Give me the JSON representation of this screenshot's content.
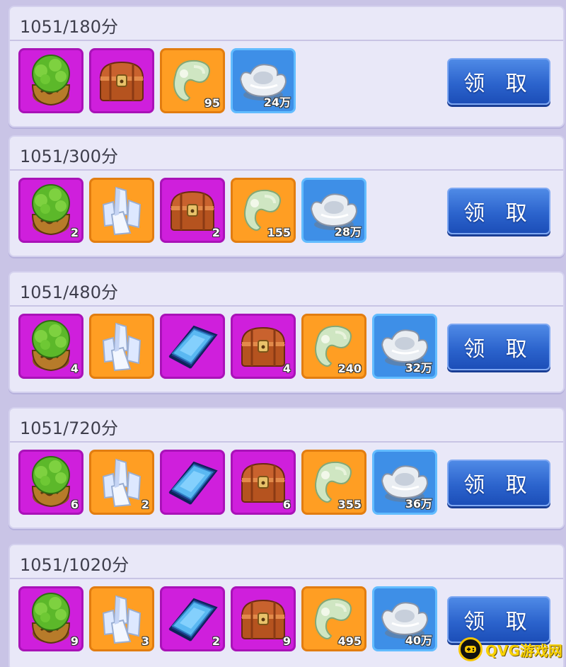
{
  "button_label": "领 取",
  "item_icons": {
    "bush": "bush-pot-icon",
    "crystal": "crystal-cluster-icon",
    "book": "skill-book-icon",
    "chest": "treasure-chest-icon",
    "jade": "jade-pendant-icon",
    "silver": "silver-ingot-icon"
  },
  "colors": {
    "purple": "#cf1fdc",
    "orange": "#ff9e23",
    "blue": "#3e8fe7",
    "button": "#2c64cd"
  },
  "tiers": [
    {
      "title": "1051/180分",
      "items": [
        {
          "icon": "bush",
          "bg": "purple",
          "qty": ""
        },
        {
          "icon": "chest",
          "bg": "purple",
          "qty": ""
        },
        {
          "icon": "jade",
          "bg": "orange",
          "qty": "95"
        },
        {
          "icon": "silver",
          "bg": "blue",
          "qty": "24万"
        }
      ]
    },
    {
      "title": "1051/300分",
      "items": [
        {
          "icon": "bush",
          "bg": "purple",
          "qty": "2"
        },
        {
          "icon": "crystal",
          "bg": "orange",
          "qty": ""
        },
        {
          "icon": "chest",
          "bg": "purple",
          "qty": "2"
        },
        {
          "icon": "jade",
          "bg": "orange",
          "qty": "155"
        },
        {
          "icon": "silver",
          "bg": "blue",
          "qty": "28万"
        }
      ]
    },
    {
      "title": "1051/480分",
      "items": [
        {
          "icon": "bush",
          "bg": "purple",
          "qty": "4"
        },
        {
          "icon": "crystal",
          "bg": "orange",
          "qty": ""
        },
        {
          "icon": "book",
          "bg": "purple",
          "qty": ""
        },
        {
          "icon": "chest",
          "bg": "purple",
          "qty": "4"
        },
        {
          "icon": "jade",
          "bg": "orange",
          "qty": "240"
        },
        {
          "icon": "silver",
          "bg": "blue",
          "qty": "32万"
        }
      ]
    },
    {
      "title": "1051/720分",
      "items": [
        {
          "icon": "bush",
          "bg": "purple",
          "qty": "6"
        },
        {
          "icon": "crystal",
          "bg": "orange",
          "qty": "2"
        },
        {
          "icon": "book",
          "bg": "purple",
          "qty": ""
        },
        {
          "icon": "chest",
          "bg": "purple",
          "qty": "6"
        },
        {
          "icon": "jade",
          "bg": "orange",
          "qty": "355"
        },
        {
          "icon": "silver",
          "bg": "blue",
          "qty": "36万"
        }
      ]
    },
    {
      "title": "1051/1020分",
      "items": [
        {
          "icon": "bush",
          "bg": "purple",
          "qty": "9"
        },
        {
          "icon": "crystal",
          "bg": "orange",
          "qty": "3"
        },
        {
          "icon": "book",
          "bg": "purple",
          "qty": "2"
        },
        {
          "icon": "chest",
          "bg": "purple",
          "qty": "9"
        },
        {
          "icon": "jade",
          "bg": "orange",
          "qty": "495"
        },
        {
          "icon": "silver",
          "bg": "blue",
          "qty": "40万"
        }
      ]
    }
  ],
  "watermark": {
    "text": "QVG游戏网",
    "icon": "gamepad-logo-icon"
  }
}
